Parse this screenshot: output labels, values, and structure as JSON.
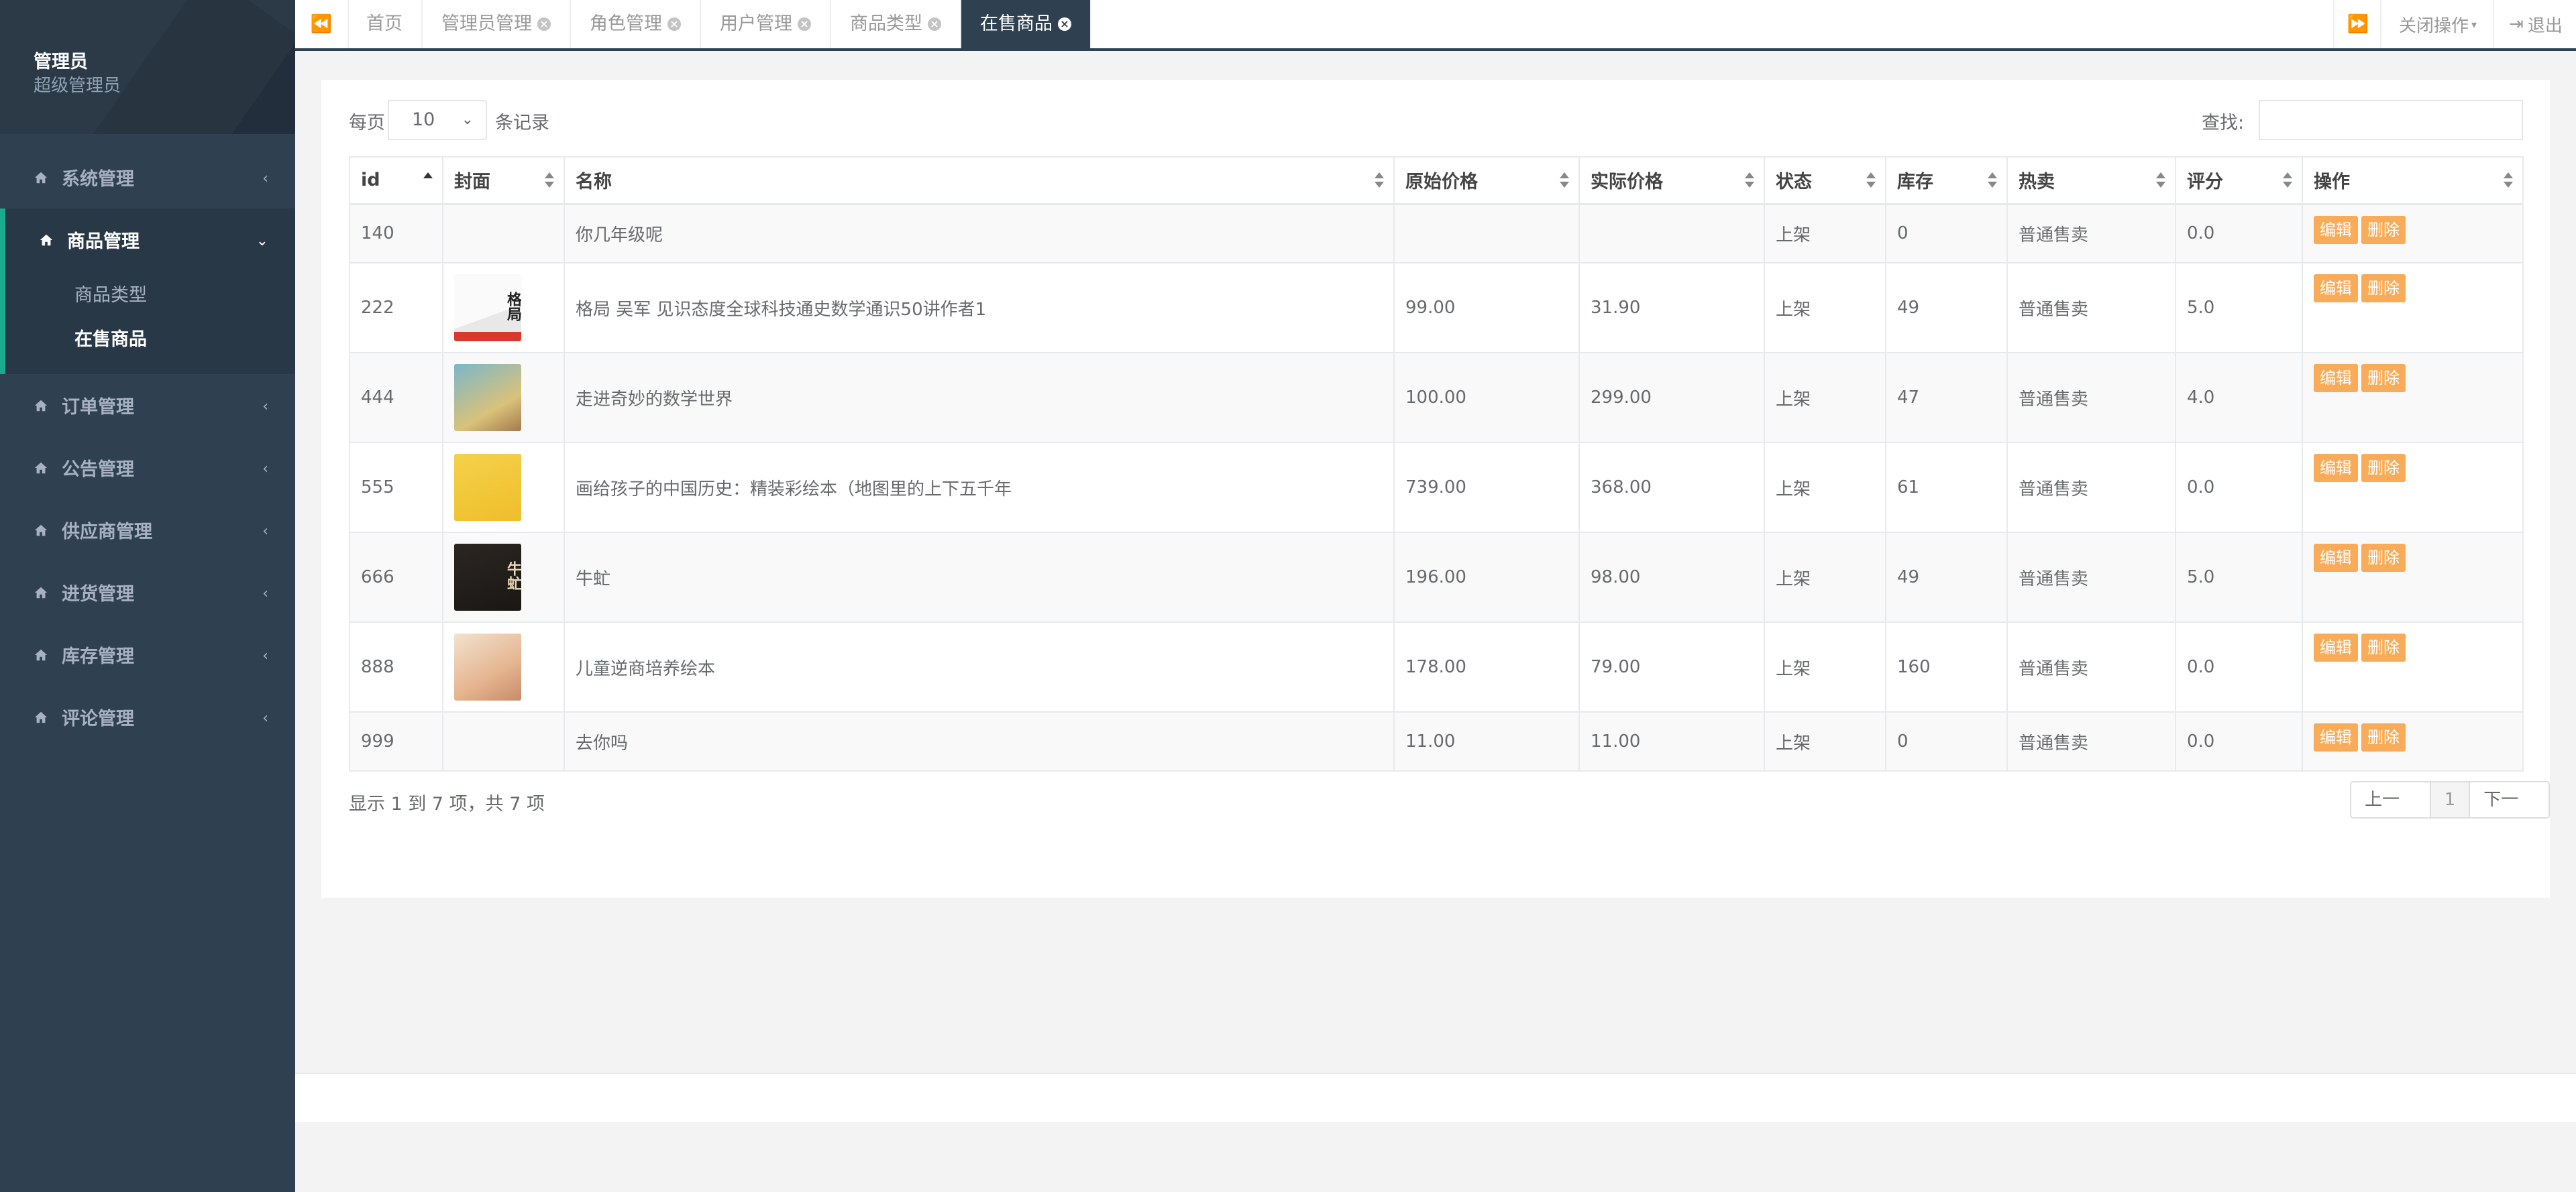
{
  "profile": {
    "name": "管理员",
    "role": "超级管理员"
  },
  "nav": {
    "items": [
      {
        "label": "系统管理"
      },
      {
        "label": "商品管理"
      },
      {
        "label": "订单管理"
      },
      {
        "label": "公告管理"
      },
      {
        "label": "供应商管理"
      },
      {
        "label": "进货管理"
      },
      {
        "label": "库存管理"
      },
      {
        "label": "评论管理"
      }
    ],
    "sub_items": [
      {
        "label": "商品类型"
      },
      {
        "label": "在售商品"
      }
    ]
  },
  "tabs": [
    {
      "label": "首页"
    },
    {
      "label": "管理员管理"
    },
    {
      "label": "角色管理"
    },
    {
      "label": "用户管理"
    },
    {
      "label": "商品类型"
    },
    {
      "label": "在售商品"
    }
  ],
  "toolbar": {
    "close_ops": "关闭操作",
    "logout": "退出"
  },
  "length_menu": {
    "prefix": "每页",
    "value": "10",
    "suffix": "条记录"
  },
  "search": {
    "label": "查找:",
    "value": ""
  },
  "table": {
    "headers": [
      "id",
      "封面",
      "名称",
      "原始价格",
      "实际价格",
      "状态",
      "库存",
      "热卖",
      "评分",
      "操作"
    ],
    "edit_label": "编辑",
    "delete_label": "删除",
    "rows": [
      {
        "id": "140",
        "name": "你几年级呢",
        "orig": "",
        "real": "",
        "status": "上架",
        "stock": "0",
        "hot": "普通售卖",
        "score": "0.0",
        "cover": ""
      },
      {
        "id": "222",
        "name": "格局 吴军 见识态度全球科技通史数学通识50讲作者1",
        "orig": "99.00",
        "real": "31.90",
        "status": "上架",
        "stock": "49",
        "hot": "普通售卖",
        "score": "5.0",
        "cover": "book-gejv"
      },
      {
        "id": "444",
        "name": "走进奇妙的数学世界",
        "orig": "100.00",
        "real": "299.00",
        "status": "上架",
        "stock": "47",
        "hot": "普通售卖",
        "score": "4.0",
        "cover": "book-math"
      },
      {
        "id": "555",
        "name": "画给孩子的中国历史：精装彩绘本（地图里的上下五千年",
        "orig": "739.00",
        "real": "368.00",
        "status": "上架",
        "stock": "61",
        "hot": "普通售卖",
        "score": "0.0",
        "cover": "book-history"
      },
      {
        "id": "666",
        "name": "牛虻",
        "orig": "196.00",
        "real": "98.00",
        "status": "上架",
        "stock": "49",
        "hot": "普通售卖",
        "score": "5.0",
        "cover": "book-gadfly"
      },
      {
        "id": "888",
        "name": "儿童逆商培养绘本",
        "orig": "178.00",
        "real": "79.00",
        "status": "上架",
        "stock": "160",
        "hot": "普通售卖",
        "score": "0.0",
        "cover": "book-kids"
      },
      {
        "id": "999",
        "name": "去你吗",
        "orig": "11.00",
        "real": "11.00",
        "status": "上架",
        "stock": "0",
        "hot": "普通售卖",
        "score": "0.0",
        "cover": ""
      }
    ]
  },
  "info": "显示 1 到 7 项，共 7 项",
  "pager": {
    "prev": "上一页",
    "current": "1",
    "next": "下一页"
  },
  "colors": {
    "sidebar": "#2f4050",
    "accent": "#19aa8d",
    "button": "#f8ac59"
  },
  "cover_glyphs": {
    "book-gejv": "格局",
    "book-gadfly": "牛虻"
  }
}
